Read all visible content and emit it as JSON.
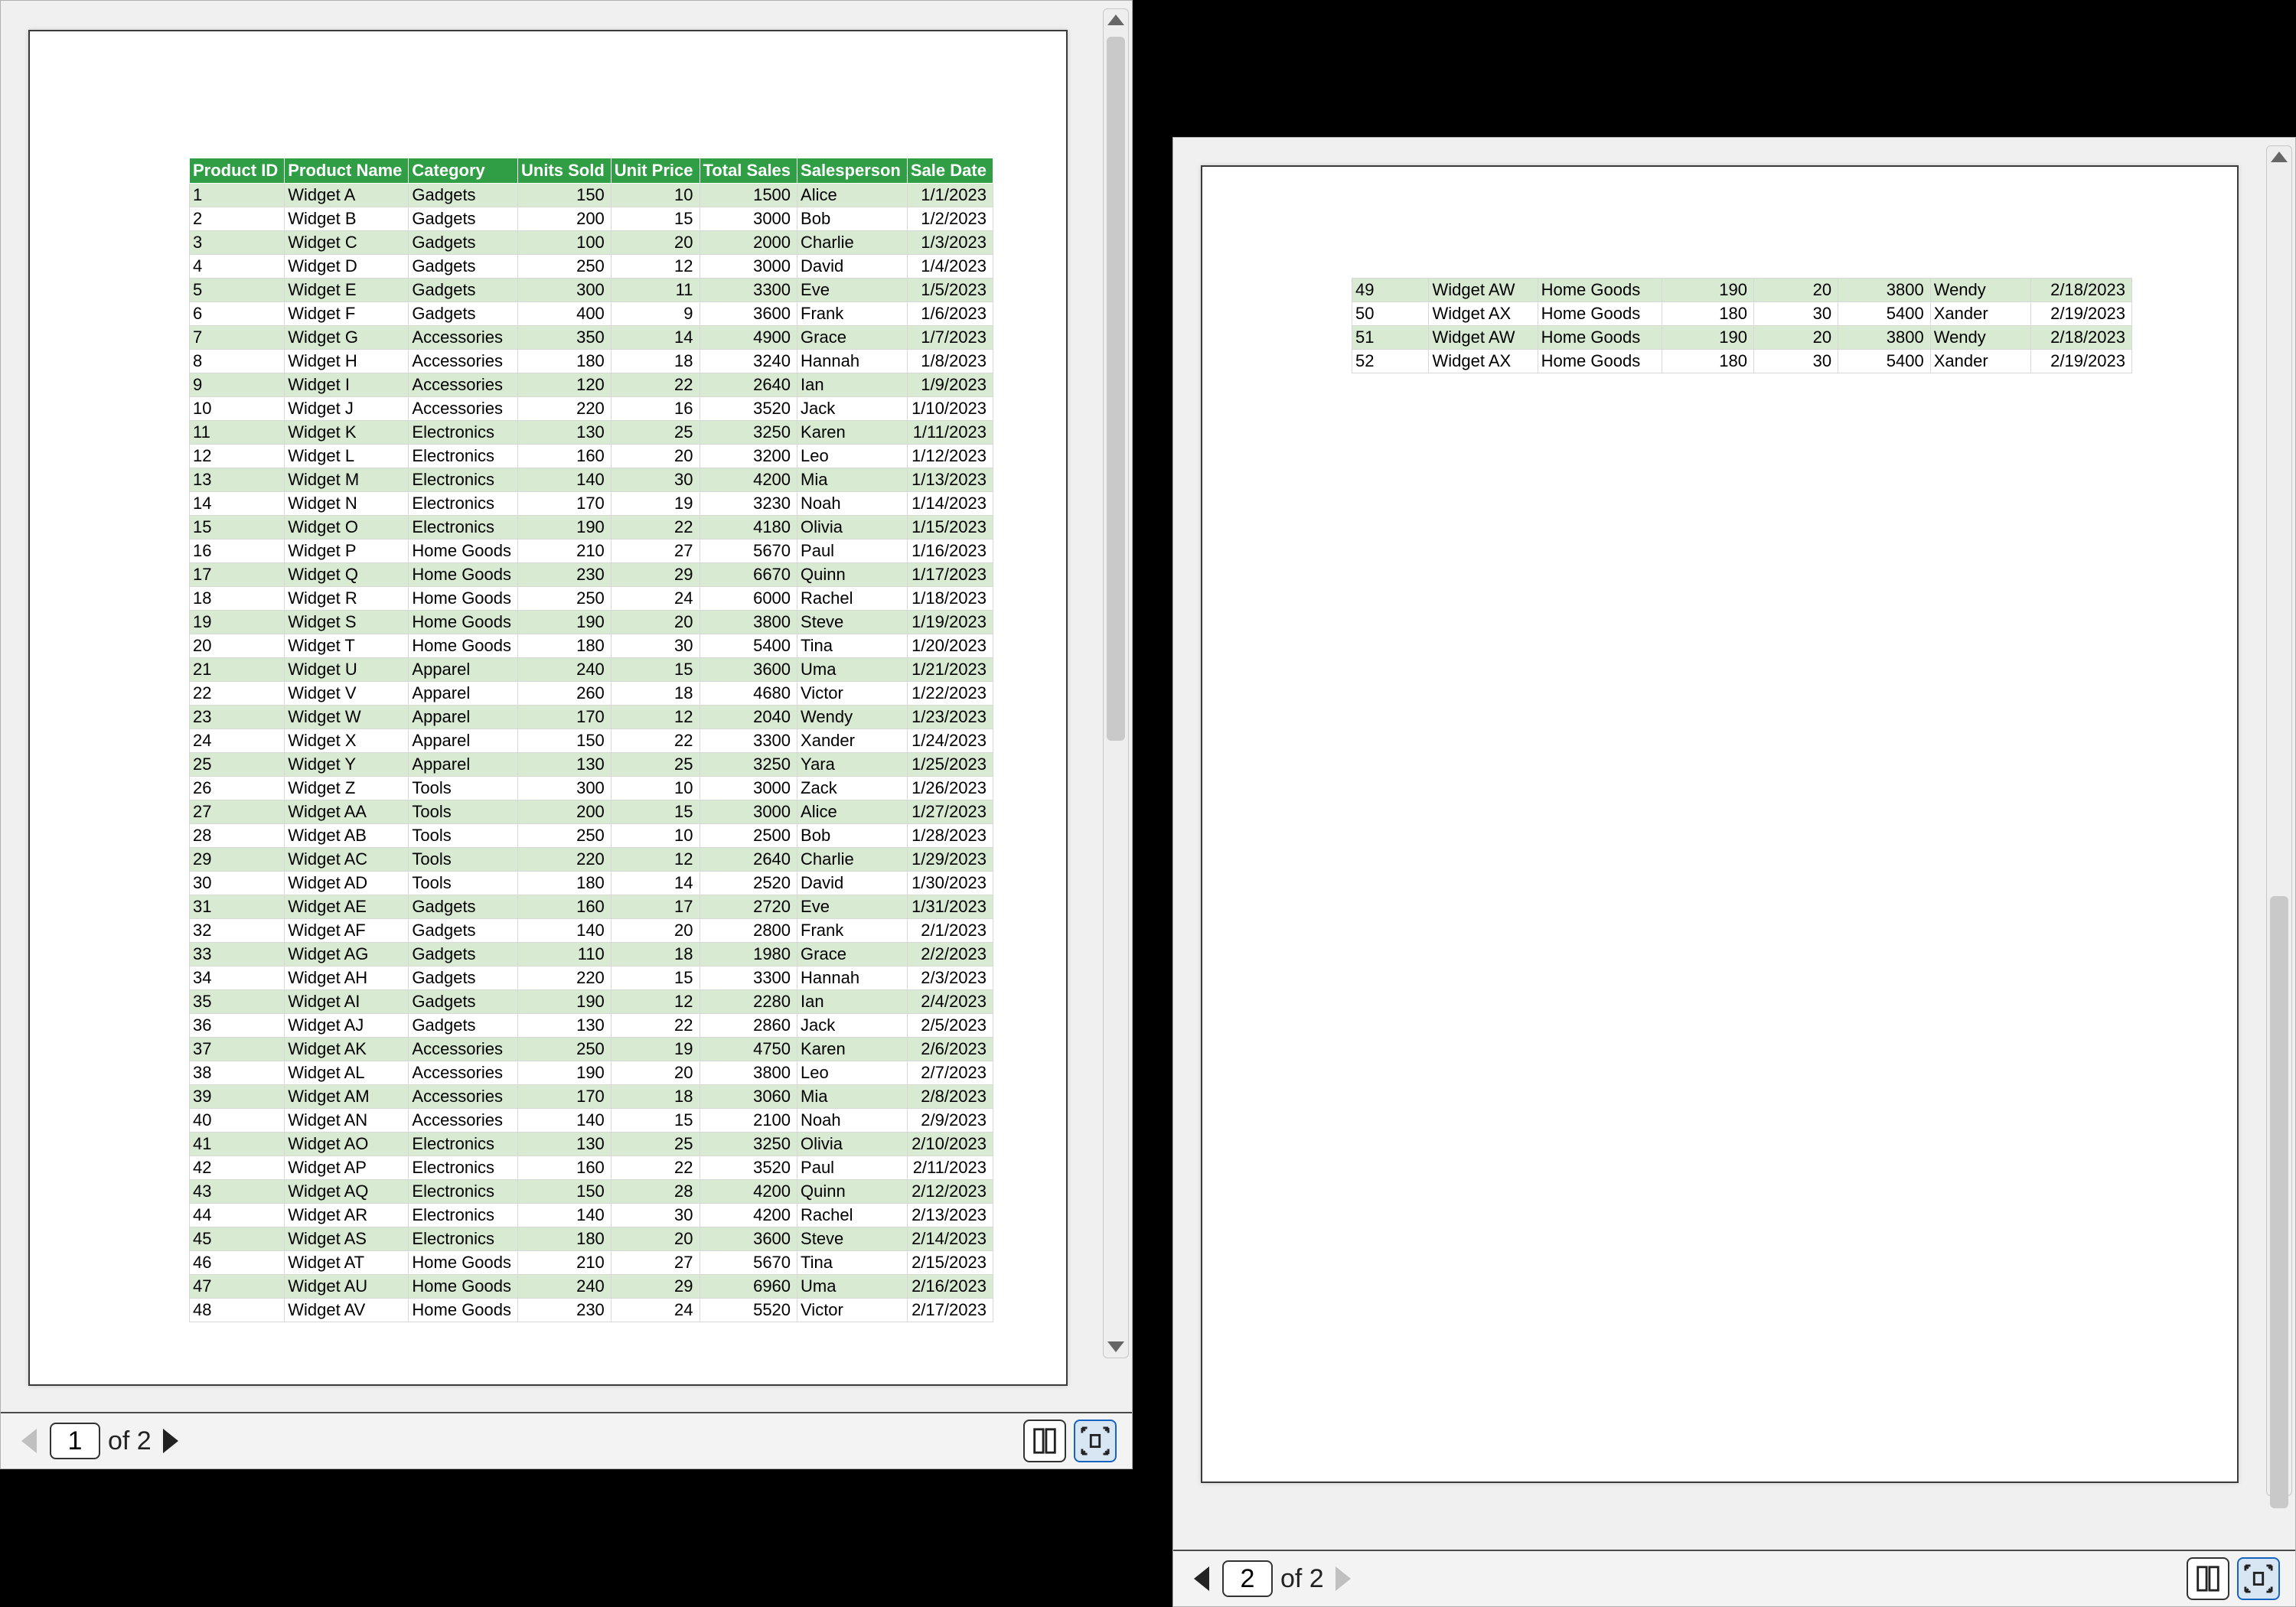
{
  "page_count_label": "of 2",
  "left": {
    "page_number": "1"
  },
  "right": {
    "page_number": "2"
  },
  "headers": [
    "Product ID",
    "Product Name",
    "Category",
    "Units Sold",
    "Unit Price",
    "Total Sales",
    "Salesperson",
    "Sale Date"
  ],
  "rows_left": [
    {
      "id": "1",
      "name": "Widget A",
      "cat": "Gadgets",
      "sold": "150",
      "price": "10",
      "tot": "1500",
      "sp": "Alice",
      "date": "1/1/2023"
    },
    {
      "id": "2",
      "name": "Widget B",
      "cat": "Gadgets",
      "sold": "200",
      "price": "15",
      "tot": "3000",
      "sp": "Bob",
      "date": "1/2/2023"
    },
    {
      "id": "3",
      "name": "Widget C",
      "cat": "Gadgets",
      "sold": "100",
      "price": "20",
      "tot": "2000",
      "sp": "Charlie",
      "date": "1/3/2023"
    },
    {
      "id": "4",
      "name": "Widget D",
      "cat": "Gadgets",
      "sold": "250",
      "price": "12",
      "tot": "3000",
      "sp": "David",
      "date": "1/4/2023"
    },
    {
      "id": "5",
      "name": "Widget E",
      "cat": "Gadgets",
      "sold": "300",
      "price": "11",
      "tot": "3300",
      "sp": "Eve",
      "date": "1/5/2023"
    },
    {
      "id": "6",
      "name": "Widget F",
      "cat": "Gadgets",
      "sold": "400",
      "price": "9",
      "tot": "3600",
      "sp": "Frank",
      "date": "1/6/2023"
    },
    {
      "id": "7",
      "name": "Widget G",
      "cat": "Accessories",
      "sold": "350",
      "price": "14",
      "tot": "4900",
      "sp": "Grace",
      "date": "1/7/2023"
    },
    {
      "id": "8",
      "name": "Widget H",
      "cat": "Accessories",
      "sold": "180",
      "price": "18",
      "tot": "3240",
      "sp": "Hannah",
      "date": "1/8/2023"
    },
    {
      "id": "9",
      "name": "Widget I",
      "cat": "Accessories",
      "sold": "120",
      "price": "22",
      "tot": "2640",
      "sp": "Ian",
      "date": "1/9/2023"
    },
    {
      "id": "10",
      "name": "Widget J",
      "cat": "Accessories",
      "sold": "220",
      "price": "16",
      "tot": "3520",
      "sp": "Jack",
      "date": "1/10/2023"
    },
    {
      "id": "11",
      "name": "Widget K",
      "cat": "Electronics",
      "sold": "130",
      "price": "25",
      "tot": "3250",
      "sp": "Karen",
      "date": "1/11/2023"
    },
    {
      "id": "12",
      "name": "Widget L",
      "cat": "Electronics",
      "sold": "160",
      "price": "20",
      "tot": "3200",
      "sp": "Leo",
      "date": "1/12/2023"
    },
    {
      "id": "13",
      "name": "Widget M",
      "cat": "Electronics",
      "sold": "140",
      "price": "30",
      "tot": "4200",
      "sp": "Mia",
      "date": "1/13/2023"
    },
    {
      "id": "14",
      "name": "Widget N",
      "cat": "Electronics",
      "sold": "170",
      "price": "19",
      "tot": "3230",
      "sp": "Noah",
      "date": "1/14/2023"
    },
    {
      "id": "15",
      "name": "Widget O",
      "cat": "Electronics",
      "sold": "190",
      "price": "22",
      "tot": "4180",
      "sp": "Olivia",
      "date": "1/15/2023"
    },
    {
      "id": "16",
      "name": "Widget P",
      "cat": "Home Goods",
      "sold": "210",
      "price": "27",
      "tot": "5670",
      "sp": "Paul",
      "date": "1/16/2023"
    },
    {
      "id": "17",
      "name": "Widget Q",
      "cat": "Home Goods",
      "sold": "230",
      "price": "29",
      "tot": "6670",
      "sp": "Quinn",
      "date": "1/17/2023"
    },
    {
      "id": "18",
      "name": "Widget R",
      "cat": "Home Goods",
      "sold": "250",
      "price": "24",
      "tot": "6000",
      "sp": "Rachel",
      "date": "1/18/2023"
    },
    {
      "id": "19",
      "name": "Widget S",
      "cat": "Home Goods",
      "sold": "190",
      "price": "20",
      "tot": "3800",
      "sp": "Steve",
      "date": "1/19/2023"
    },
    {
      "id": "20",
      "name": "Widget T",
      "cat": "Home Goods",
      "sold": "180",
      "price": "30",
      "tot": "5400",
      "sp": "Tina",
      "date": "1/20/2023"
    },
    {
      "id": "21",
      "name": "Widget U",
      "cat": "Apparel",
      "sold": "240",
      "price": "15",
      "tot": "3600",
      "sp": "Uma",
      "date": "1/21/2023"
    },
    {
      "id": "22",
      "name": "Widget V",
      "cat": "Apparel",
      "sold": "260",
      "price": "18",
      "tot": "4680",
      "sp": "Victor",
      "date": "1/22/2023"
    },
    {
      "id": "23",
      "name": "Widget W",
      "cat": "Apparel",
      "sold": "170",
      "price": "12",
      "tot": "2040",
      "sp": "Wendy",
      "date": "1/23/2023"
    },
    {
      "id": "24",
      "name": "Widget X",
      "cat": "Apparel",
      "sold": "150",
      "price": "22",
      "tot": "3300",
      "sp": "Xander",
      "date": "1/24/2023"
    },
    {
      "id": "25",
      "name": "Widget Y",
      "cat": "Apparel",
      "sold": "130",
      "price": "25",
      "tot": "3250",
      "sp": "Yara",
      "date": "1/25/2023"
    },
    {
      "id": "26",
      "name": "Widget Z",
      "cat": "Tools",
      "sold": "300",
      "price": "10",
      "tot": "3000",
      "sp": "Zack",
      "date": "1/26/2023"
    },
    {
      "id": "27",
      "name": "Widget AA",
      "cat": "Tools",
      "sold": "200",
      "price": "15",
      "tot": "3000",
      "sp": "Alice",
      "date": "1/27/2023"
    },
    {
      "id": "28",
      "name": "Widget AB",
      "cat": "Tools",
      "sold": "250",
      "price": "10",
      "tot": "2500",
      "sp": "Bob",
      "date": "1/28/2023"
    },
    {
      "id": "29",
      "name": "Widget AC",
      "cat": "Tools",
      "sold": "220",
      "price": "12",
      "tot": "2640",
      "sp": "Charlie",
      "date": "1/29/2023"
    },
    {
      "id": "30",
      "name": "Widget AD",
      "cat": "Tools",
      "sold": "180",
      "price": "14",
      "tot": "2520",
      "sp": "David",
      "date": "1/30/2023"
    },
    {
      "id": "31",
      "name": "Widget AE",
      "cat": "Gadgets",
      "sold": "160",
      "price": "17",
      "tot": "2720",
      "sp": "Eve",
      "date": "1/31/2023"
    },
    {
      "id": "32",
      "name": "Widget AF",
      "cat": "Gadgets",
      "sold": "140",
      "price": "20",
      "tot": "2800",
      "sp": "Frank",
      "date": "2/1/2023"
    },
    {
      "id": "33",
      "name": "Widget AG",
      "cat": "Gadgets",
      "sold": "110",
      "price": "18",
      "tot": "1980",
      "sp": "Grace",
      "date": "2/2/2023"
    },
    {
      "id": "34",
      "name": "Widget AH",
      "cat": "Gadgets",
      "sold": "220",
      "price": "15",
      "tot": "3300",
      "sp": "Hannah",
      "date": "2/3/2023"
    },
    {
      "id": "35",
      "name": "Widget AI",
      "cat": "Gadgets",
      "sold": "190",
      "price": "12",
      "tot": "2280",
      "sp": "Ian",
      "date": "2/4/2023"
    },
    {
      "id": "36",
      "name": "Widget AJ",
      "cat": "Gadgets",
      "sold": "130",
      "price": "22",
      "tot": "2860",
      "sp": "Jack",
      "date": "2/5/2023"
    },
    {
      "id": "37",
      "name": "Widget AK",
      "cat": "Accessories",
      "sold": "250",
      "price": "19",
      "tot": "4750",
      "sp": "Karen",
      "date": "2/6/2023"
    },
    {
      "id": "38",
      "name": "Widget AL",
      "cat": "Accessories",
      "sold": "190",
      "price": "20",
      "tot": "3800",
      "sp": "Leo",
      "date": "2/7/2023"
    },
    {
      "id": "39",
      "name": "Widget AM",
      "cat": "Accessories",
      "sold": "170",
      "price": "18",
      "tot": "3060",
      "sp": "Mia",
      "date": "2/8/2023"
    },
    {
      "id": "40",
      "name": "Widget AN",
      "cat": "Accessories",
      "sold": "140",
      "price": "15",
      "tot": "2100",
      "sp": "Noah",
      "date": "2/9/2023"
    },
    {
      "id": "41",
      "name": "Widget AO",
      "cat": "Electronics",
      "sold": "130",
      "price": "25",
      "tot": "3250",
      "sp": "Olivia",
      "date": "2/10/2023"
    },
    {
      "id": "42",
      "name": "Widget AP",
      "cat": "Electronics",
      "sold": "160",
      "price": "22",
      "tot": "3520",
      "sp": "Paul",
      "date": "2/11/2023"
    },
    {
      "id": "43",
      "name": "Widget AQ",
      "cat": "Electronics",
      "sold": "150",
      "price": "28",
      "tot": "4200",
      "sp": "Quinn",
      "date": "2/12/2023"
    },
    {
      "id": "44",
      "name": "Widget AR",
      "cat": "Electronics",
      "sold": "140",
      "price": "30",
      "tot": "4200",
      "sp": "Rachel",
      "date": "2/13/2023"
    },
    {
      "id": "45",
      "name": "Widget AS",
      "cat": "Electronics",
      "sold": "180",
      "price": "20",
      "tot": "3600",
      "sp": "Steve",
      "date": "2/14/2023"
    },
    {
      "id": "46",
      "name": "Widget AT",
      "cat": "Home Goods",
      "sold": "210",
      "price": "27",
      "tot": "5670",
      "sp": "Tina",
      "date": "2/15/2023"
    },
    {
      "id": "47",
      "name": "Widget AU",
      "cat": "Home Goods",
      "sold": "240",
      "price": "29",
      "tot": "6960",
      "sp": "Uma",
      "date": "2/16/2023"
    },
    {
      "id": "48",
      "name": "Widget AV",
      "cat": "Home Goods",
      "sold": "230",
      "price": "24",
      "tot": "5520",
      "sp": "Victor",
      "date": "2/17/2023"
    }
  ],
  "rows_right": [
    {
      "id": "49",
      "name": "Widget AW",
      "cat": "Home Goods",
      "sold": "190",
      "price": "20",
      "tot": "3800",
      "sp": "Wendy",
      "date": "2/18/2023"
    },
    {
      "id": "50",
      "name": "Widget AX",
      "cat": "Home Goods",
      "sold": "180",
      "price": "30",
      "tot": "5400",
      "sp": "Xander",
      "date": "2/19/2023"
    },
    {
      "id": "51",
      "name": "Widget AW",
      "cat": "Home Goods",
      "sold": "190",
      "price": "20",
      "tot": "3800",
      "sp": "Wendy",
      "date": "2/18/2023"
    },
    {
      "id": "52",
      "name": "Widget AX",
      "cat": "Home Goods",
      "sold": "180",
      "price": "30",
      "tot": "5400",
      "sp": "Xander",
      "date": "2/19/2023"
    }
  ]
}
